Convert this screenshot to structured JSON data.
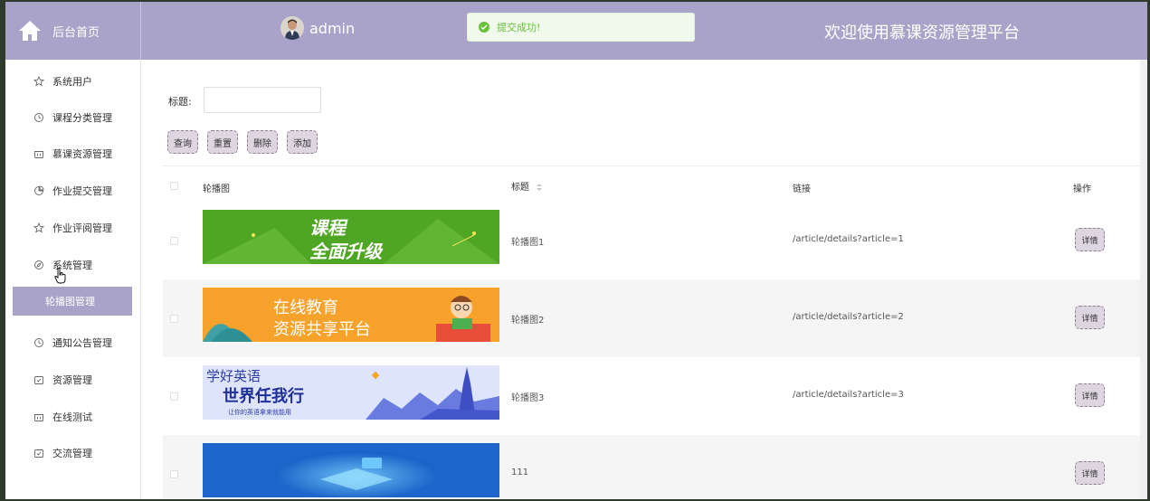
{
  "header": {
    "home_label": "后台首页",
    "username": "admin",
    "toast": "提交成功!",
    "welcome": "欢迎使用慕课资源管理平台",
    "bg_color": "#a9a3c9"
  },
  "sidebar": {
    "items": [
      {
        "label": "系统用户",
        "icon": "star-icon"
      },
      {
        "label": "课程分类管理",
        "icon": "clock-icon"
      },
      {
        "label": "慕课资源管理",
        "icon": "basket-icon"
      },
      {
        "label": "作业提交管理",
        "icon": "pie-icon"
      },
      {
        "label": "作业评阅管理",
        "icon": "star-icon"
      },
      {
        "label": "系统管理",
        "icon": "compass-icon"
      },
      {
        "label": "通知公告管理",
        "icon": "clock-icon"
      },
      {
        "label": "资源管理",
        "icon": "calendar-check-icon"
      },
      {
        "label": "在线测试",
        "icon": "basket-icon"
      },
      {
        "label": "交流管理",
        "icon": "calendar-check-icon"
      }
    ],
    "active_sub": "轮播图管理"
  },
  "search": {
    "title_label": "标题:",
    "title_value": ""
  },
  "toolbar": {
    "query": "查询",
    "reset": "重置",
    "delete": "删除",
    "add": "添加"
  },
  "table": {
    "headers": {
      "image": "轮播图",
      "title": "标题",
      "link": "链接",
      "action": "操作"
    },
    "rows": [
      {
        "title": "轮播图1",
        "link": "/article/details?article=1",
        "banner": [
          "课程",
          "全面升级"
        ]
      },
      {
        "title": "轮播图2",
        "link": "/article/details?article=2",
        "banner": [
          "在线教育",
          "资源共享平台"
        ]
      },
      {
        "title": "轮播图3",
        "link": "/article/details?article=3",
        "banner": [
          "学好英语",
          "世界任我行",
          "让你的英语拿来就能用"
        ]
      },
      {
        "title": "111",
        "link": "",
        "banner": []
      }
    ],
    "detail_label": "详情"
  }
}
